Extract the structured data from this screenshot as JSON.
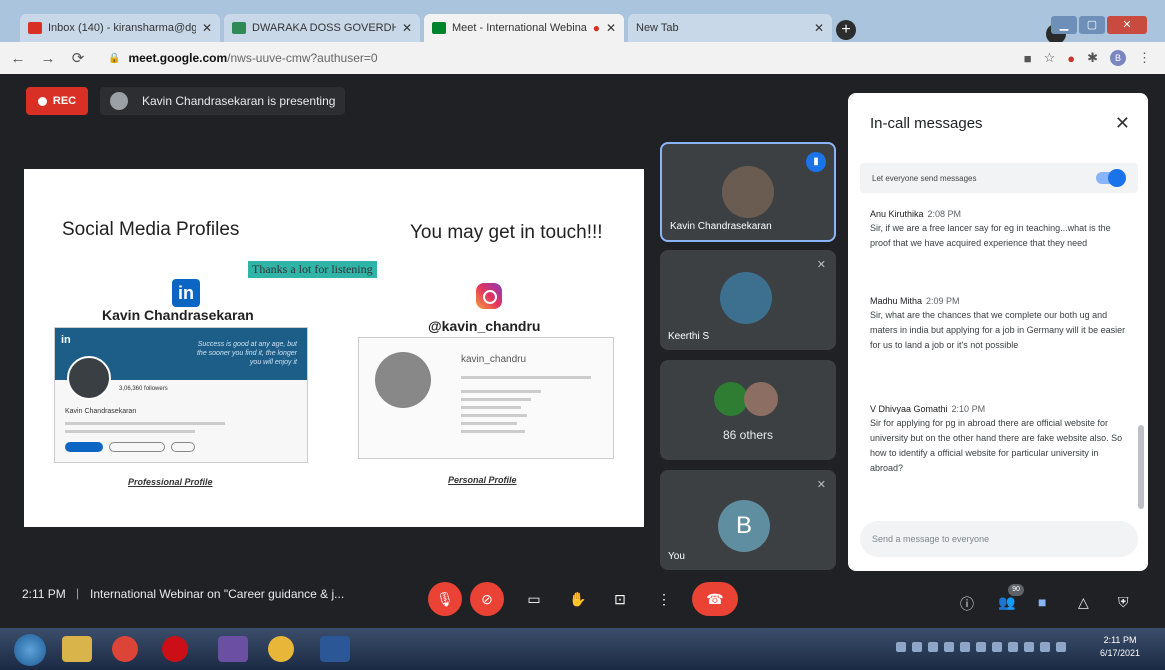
{
  "browser": {
    "tabs": [
      {
        "title": "Inbox (140) - kiransharma@dgv...",
        "active": false
      },
      {
        "title": "DWARAKA DOSS GOVERDHAN D...",
        "active": false
      },
      {
        "title": "Meet - International Webina",
        "active": true
      },
      {
        "title": "New Tab",
        "active": false
      }
    ],
    "new_tab": "+",
    "url_domain": "meet.google.com",
    "url_path": "/nws-uuve-cmw?authuser=0"
  },
  "meet": {
    "rec_label": "REC",
    "presenting_text": "Kavin Chandrasekaran is presenting",
    "slide": {
      "heading_left": "Social Media Profiles",
      "heading_right": "You may get in touch!!!",
      "thanks": "Thanks a lot for listening",
      "linkedin_logo": "in",
      "linkedin_name": "Kavin Chandrasekaran",
      "instagram_handle": "@kavin_chandru",
      "li_card": {
        "logo": "in",
        "quote": "Success is good at any age, but the sooner you find it, the longer you will enjoy it",
        "followers": "3,06,360 followers",
        "name": "Kavin Chandrasekaran"
      },
      "ig_card": {
        "username": "kavin_chandru"
      },
      "caption_left": "Professional Profile",
      "caption_right": "Personal Profile"
    },
    "participants": [
      {
        "name": "Kavin Chandrasekaran",
        "state": "speaking"
      },
      {
        "name": "Keerthi S",
        "state": "muted"
      },
      {
        "name": "86 others",
        "state": "group"
      },
      {
        "name": "You",
        "initial": "B",
        "state": "muted"
      }
    ],
    "chat": {
      "title": "In-call messages",
      "toggle_label": "Let everyone send messages",
      "messages": [
        {
          "sender": "Anu Kiruthika",
          "time": "2:08 PM",
          "text": "Sir, if we are a free lancer say for eg in teaching...what is the proof that we have acquired experience that they need"
        },
        {
          "sender": "Madhu Mitha",
          "time": "2:09 PM",
          "text": "Sir, what are the chances that we complete our both ug and maters in india but applying for a job in Germany will it be easier for us to land a job or it's not possible"
        },
        {
          "sender": "V Dhivyaa Gomathi",
          "time": "2:10 PM",
          "text": "Sir for applying for pg in abroad there are official website for university but on the other hand there are fake website also. So how to identify a official website for particular university in abroad?"
        }
      ],
      "input_placeholder": "Send a message to everyone"
    },
    "bottom": {
      "time": "2:11 PM",
      "separator": "|",
      "meeting_title": "International Webinar on \"Career guidance & j...",
      "people_count": "90"
    }
  },
  "taskbar": {
    "clock_time": "2:11 PM",
    "clock_date": "6/17/2021"
  },
  "colors": {
    "meet_bg": "#202124",
    "accent_blue": "#1a73e8",
    "danger_red": "#ea4335"
  }
}
